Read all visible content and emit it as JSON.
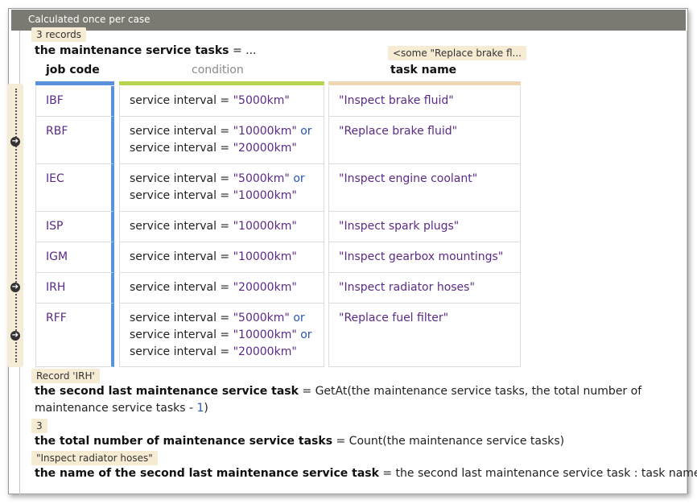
{
  "header": {
    "title": "Calculated once per case"
  },
  "table_section": {
    "records_badge": "3 records",
    "name": "the maintenance service tasks",
    "op": " = ...",
    "task_name_badge": "<some \"Replace brake fl...",
    "columns": {
      "job_code": "job code",
      "condition": "condition",
      "task_name": "task name"
    },
    "colors": {
      "job_code": "#5b90dd",
      "condition": "#b5d64e",
      "task_name": "#efd7b6"
    },
    "rows": [
      {
        "job_code": "IBF",
        "condition": [
          {
            "pre": "service interval = ",
            "val": "\"5000km\"",
            "post": ""
          }
        ],
        "task_name": "\"Inspect brake fluid\""
      },
      {
        "job_code": "RBF",
        "condition": [
          {
            "pre": "service interval = ",
            "val": "\"10000km\"",
            "post": " or"
          },
          {
            "pre": "service interval = ",
            "val": "\"20000km\"",
            "post": ""
          }
        ],
        "task_name": "\"Replace brake fluid\""
      },
      {
        "job_code": "IEC",
        "condition": [
          {
            "pre": "service interval = ",
            "val": "\"5000km\"",
            "post": " or"
          },
          {
            "pre": "service interval = ",
            "val": "\"10000km\"",
            "post": ""
          }
        ],
        "task_name": "\"Inspect engine coolant\""
      },
      {
        "job_code": "ISP",
        "condition": [
          {
            "pre": "service interval = ",
            "val": "\"10000km\"",
            "post": ""
          }
        ],
        "task_name": "\"Inspect spark plugs\""
      },
      {
        "job_code": "IGM",
        "condition": [
          {
            "pre": "service interval = ",
            "val": "\"10000km\"",
            "post": ""
          }
        ],
        "task_name": "\"Inspect gearbox mountings\""
      },
      {
        "job_code": "IRH",
        "condition": [
          {
            "pre": "service interval = ",
            "val": "\"20000km\"",
            "post": ""
          }
        ],
        "task_name": "\"Inspect radiator hoses\""
      },
      {
        "job_code": "RFF",
        "condition": [
          {
            "pre": "service interval = ",
            "val": "\"5000km\"",
            "post": " or"
          },
          {
            "pre": "service interval = ",
            "val": "\"10000km\"",
            "post": " or"
          },
          {
            "pre": "service interval = ",
            "val": "\"20000km\"",
            "post": ""
          }
        ],
        "task_name": "\"Replace fuel filter\""
      }
    ]
  },
  "second_last": {
    "badge": "Record 'IRH'",
    "name": "the second last maintenance service task",
    "expr_line1": " = GetAt(the maintenance service tasks, the total number of",
    "expr_line2_pre": "maintenance service tasks - ",
    "expr_line2_num": "1",
    "expr_line2_post": ")"
  },
  "total": {
    "badge": "3",
    "name": "the total number of maintenance service tasks",
    "expr": " = Count(the maintenance service tasks)"
  },
  "task_name_value": {
    "badge": "\"Inspect radiator hoses\"",
    "name": "the name of the second last maintenance service task",
    "expr": " = the second last maintenance service task : task name"
  }
}
